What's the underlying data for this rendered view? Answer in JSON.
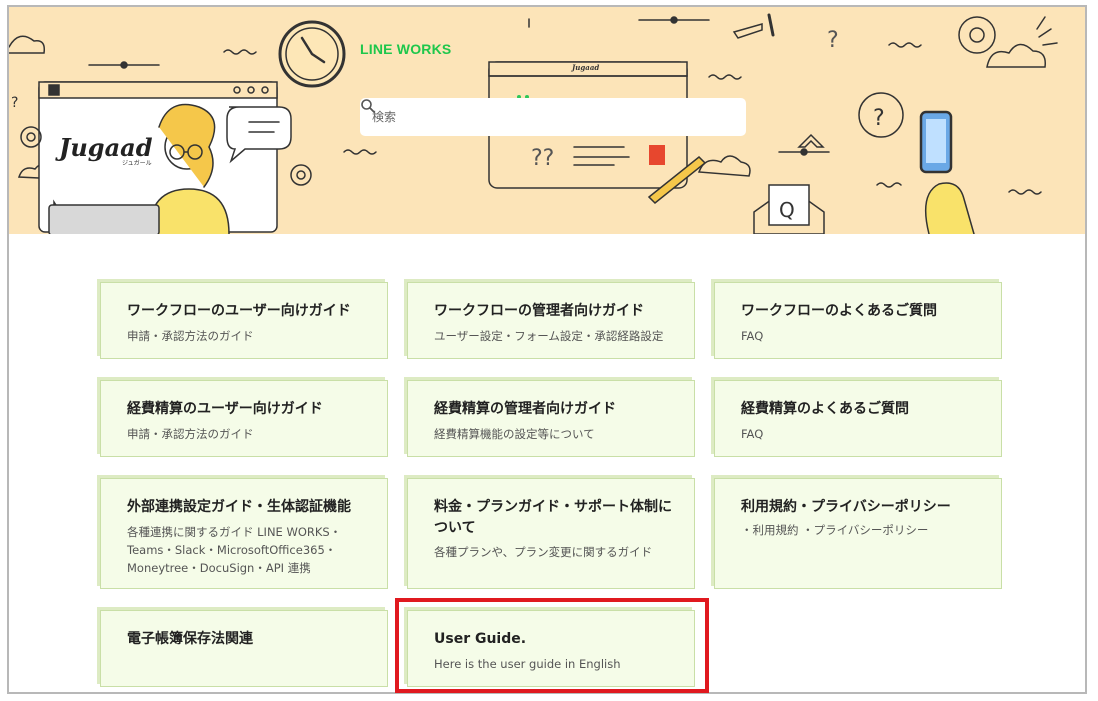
{
  "hero": {
    "brand": "LINE WORKS",
    "logo": "Jugaad",
    "logo_sub": "ジュガール",
    "mini_logo": "Jugaad",
    "search_placeholder": "検索"
  },
  "cards": [
    {
      "title": "ワークフローのユーザー向けガイド",
      "desc": "申請・承認方法のガイド"
    },
    {
      "title": "ワークフローの管理者向けガイド",
      "desc": "ユーザー設定・フォーム設定・承認経路設定"
    },
    {
      "title": "ワークフローのよくあるご質問",
      "desc": "FAQ"
    },
    {
      "title": "経費精算のユーザー向けガイド",
      "desc": "申請・承認方法のガイド"
    },
    {
      "title": "経費精算の管理者向けガイド",
      "desc": "経費精算機能の設定等について"
    },
    {
      "title": "経費精算のよくあるご質問",
      "desc": "FAQ"
    },
    {
      "title": "外部連携設定ガイド・生体認証機能",
      "desc": "各種連携に関するガイド LINE WORKS・Teams・Slack・MicrosoftOffice365・Moneytree・DocuSign・API 連携"
    },
    {
      "title": "料金・プランガイド・サポート体制について",
      "desc": "各種プランや、プラン変更に関するガイド"
    },
    {
      "title": "利用規約・プライバシーポリシー",
      "desc": "・利用規約 ・プライバシーポリシー"
    },
    {
      "title": "電子帳簿保存法関連",
      "desc": ""
    },
    {
      "title": "User Guide.",
      "desc": "Here is the user guide in English"
    }
  ]
}
